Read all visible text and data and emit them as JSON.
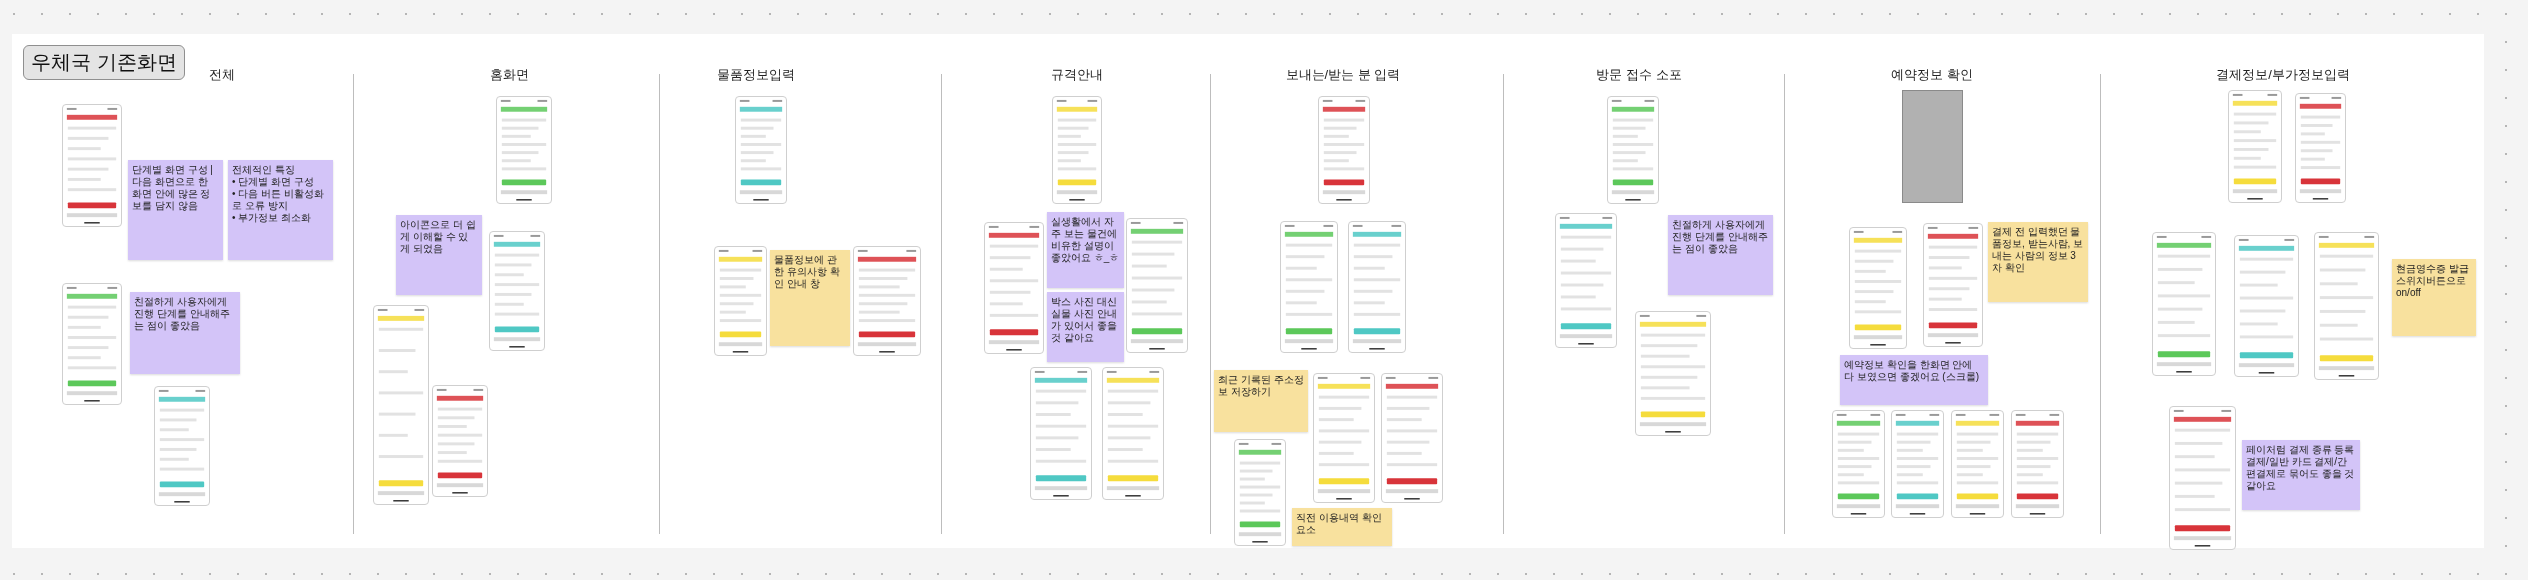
{
  "board": {
    "title": "우체국 기존화면"
  },
  "sections": [
    {
      "heading": "전체",
      "screens": [
        {
          "kind": "phone"
        },
        {
          "kind": "phone"
        },
        {
          "kind": "phone"
        }
      ],
      "notes": [
        {
          "color": "#d3c4f8",
          "text": "단계별 화면 구성 | 다음 화면으로 한 화면 안에 많은 정보를 담지 않음"
        },
        {
          "color": "#d3c4f8",
          "text": "전체적인 특징\n• 단계별 화면 구성\n• 다음 버튼 비활성화로 오류 방지\n• 부가정보 최소화"
        },
        {
          "color": "#d3c4f8",
          "text": "친절하게 사용자에게 진행 단계를 안내해주는 점이 좋았음"
        }
      ]
    },
    {
      "heading": "홈화면",
      "screens": [
        {
          "kind": "phone"
        },
        {
          "kind": "phone"
        },
        {
          "kind": "phone"
        },
        {
          "kind": "phone"
        }
      ],
      "notes": [
        {
          "color": "#d3c4f8",
          "text": "아이콘으로 더 쉽게 이해할 수 있게 되었음"
        }
      ]
    },
    {
      "heading": "물품정보입력",
      "screens": [
        {
          "kind": "phone"
        },
        {
          "kind": "phone"
        },
        {
          "kind": "phone"
        }
      ],
      "notes": [
        {
          "color": "#f8e19e",
          "text": "물품정보에 관한 유의사항 확인 안내 창"
        }
      ]
    },
    {
      "heading": "규격안내",
      "screens": [
        {
          "kind": "phone"
        },
        {
          "kind": "phone"
        },
        {
          "kind": "phone"
        },
        {
          "kind": "phone"
        },
        {
          "kind": "phone"
        }
      ],
      "notes": [
        {
          "color": "#d3c4f8",
          "text": "실생활에서 자주 보는 물건에 비유한 설명이 좋았어요 ㅎ_ㅎ"
        },
        {
          "color": "#d3c4f8",
          "text": "박스 사진 대신 실물 사진 안내가 있어서 좋을 것 같아요"
        }
      ]
    },
    {
      "heading": "보내는/받는 분 입력",
      "screens": [
        {
          "kind": "phone"
        },
        {
          "kind": "phone"
        },
        {
          "kind": "phone"
        },
        {
          "kind": "phone"
        },
        {
          "kind": "phone"
        },
        {
          "kind": "phone"
        }
      ],
      "notes": [
        {
          "color": "#f8e19e",
          "text": "최근 기록된 주소정보 저장하기"
        },
        {
          "color": "#f8e19e",
          "text": "직전 이용내역 확인 요소"
        }
      ]
    },
    {
      "heading": "방문 접수 소포",
      "screens": [
        {
          "kind": "phone"
        },
        {
          "kind": "phone"
        },
        {
          "kind": "phone"
        }
      ],
      "notes": [
        {
          "color": "#d3c4f8",
          "text": "친절하게 사용자에게 진행 단계를 안내해주는 점이 좋았음"
        }
      ]
    },
    {
      "heading": "예약정보 확인",
      "screens": [
        {
          "kind": "placeholder"
        },
        {
          "kind": "phone"
        },
        {
          "kind": "phone"
        },
        {
          "kind": "phone"
        },
        {
          "kind": "phone"
        },
        {
          "kind": "phone"
        },
        {
          "kind": "phone"
        }
      ],
      "notes": [
        {
          "color": "#f8e19e",
          "text": "결제 전 입력했던 물품정보, 받는사람, 보내는 사람의 정보 3차 확인"
        },
        {
          "color": "#d3c4f8",
          "text": "예약정보 확인을 한화면 안에 다 보였으면 좋겠어요 (스크롤)"
        }
      ]
    },
    {
      "heading": "결제정보/부가정보입력",
      "screens": [
        {
          "kind": "phone"
        },
        {
          "kind": "phone"
        },
        {
          "kind": "phone"
        },
        {
          "kind": "phone"
        },
        {
          "kind": "phone"
        },
        {
          "kind": "phone"
        }
      ],
      "notes": [
        {
          "color": "#f8e19e",
          "text": "현금영수증 발급 스위치버튼으로 on/off"
        },
        {
          "color": "#d3c4f8",
          "text": "페이처럼 결제 종류 등록결제/일반 카드 결제/간편결제로 묶어도 좋을 것 같아요"
        }
      ]
    }
  ]
}
